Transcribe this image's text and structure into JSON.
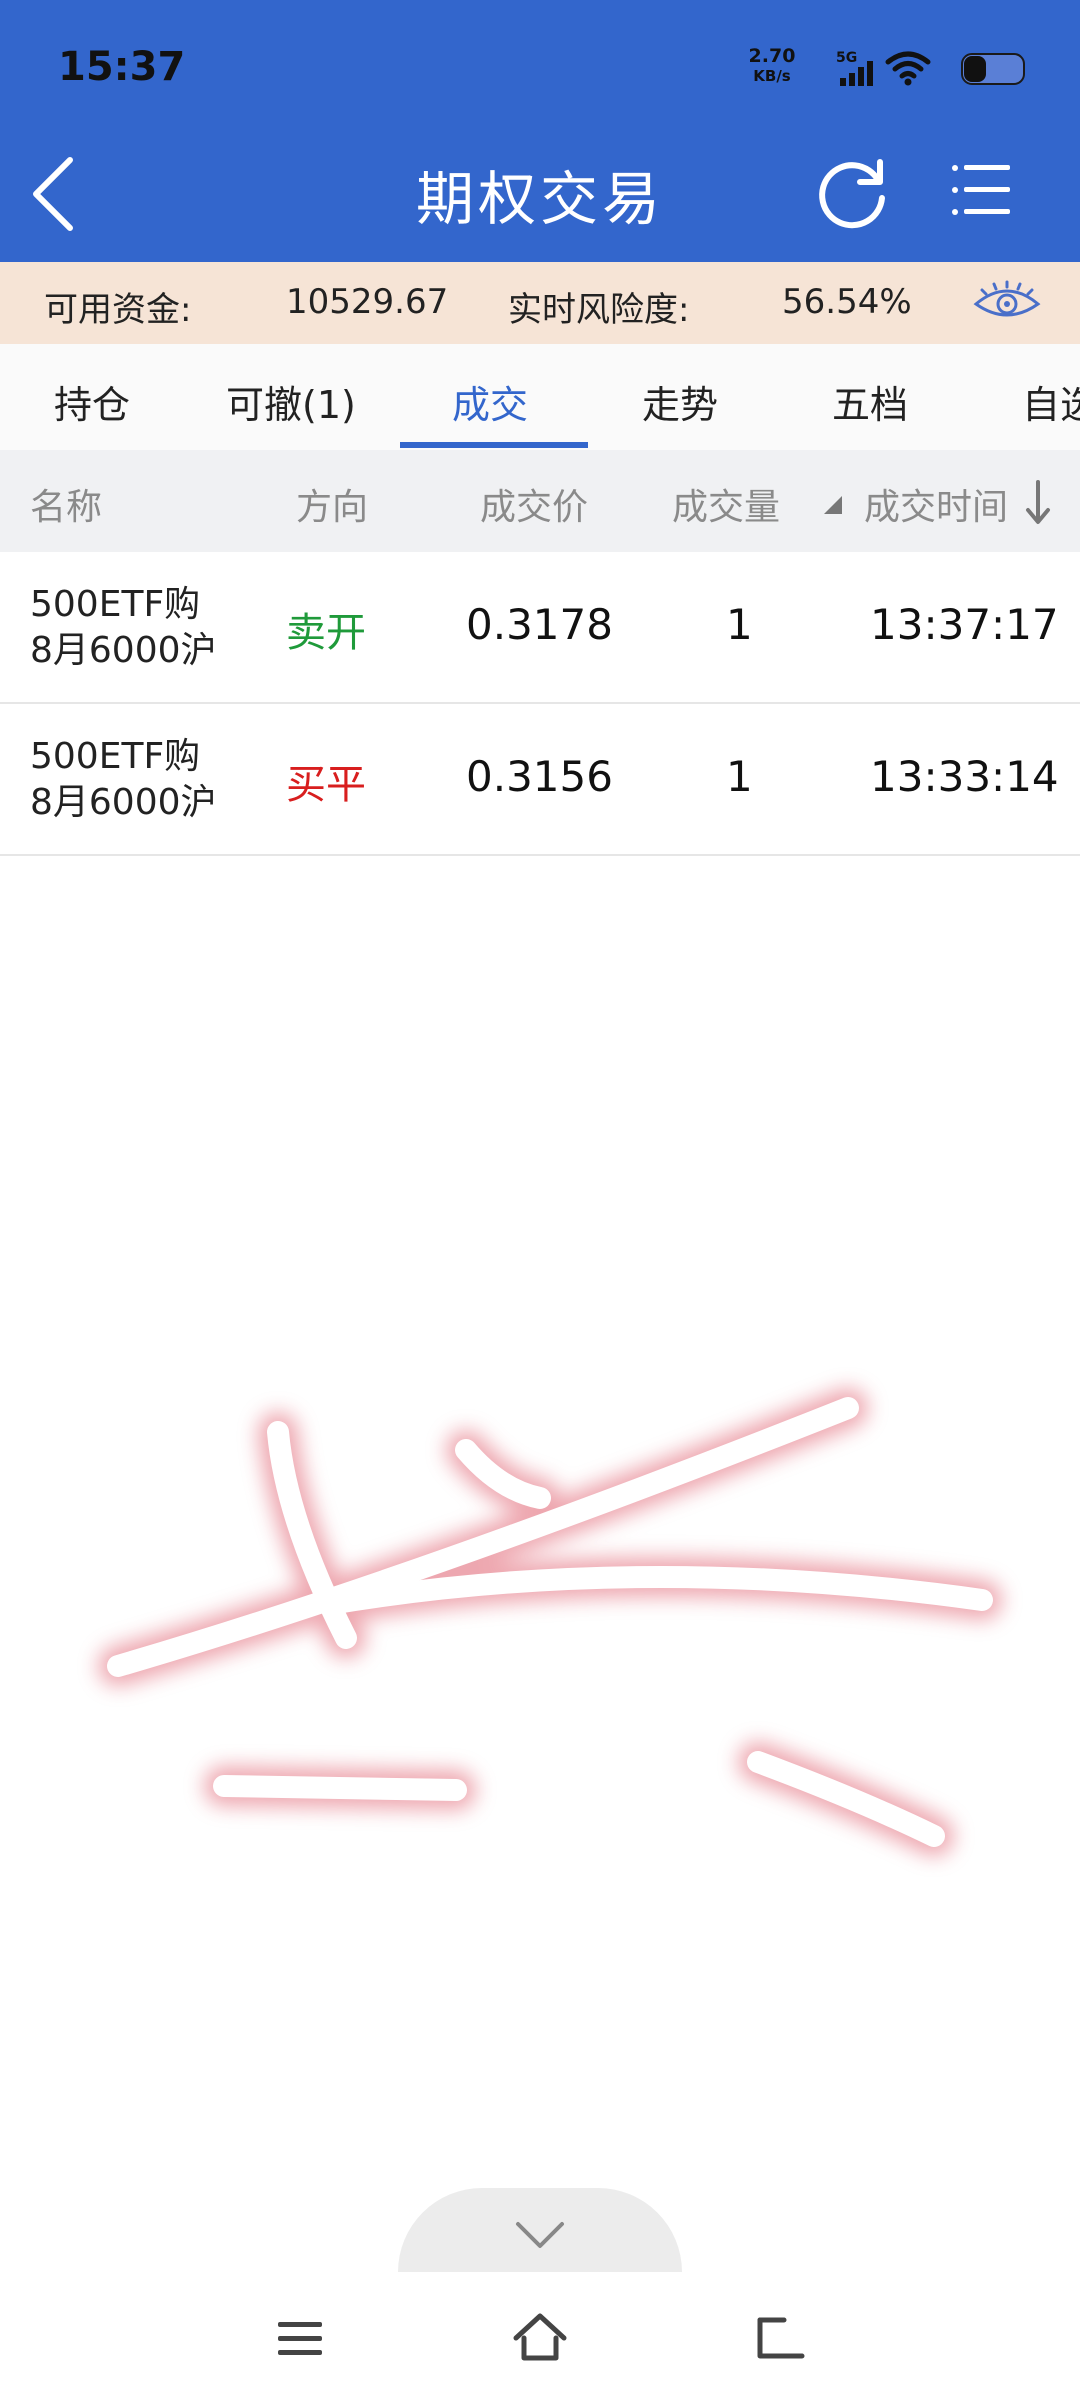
{
  "status_bar": {
    "time": "15:37",
    "net_speed_value": "2.70",
    "net_speed_unit": "KB/s",
    "network": "5G"
  },
  "header": {
    "title": "期权交易",
    "icons": [
      "back-icon",
      "refresh-icon",
      "list-menu-icon"
    ]
  },
  "account": {
    "funds_label": "可用资金:",
    "funds_value": "10529.67",
    "risk_label": "实时风险度:",
    "risk_value": "56.54%"
  },
  "tabs": [
    {
      "label": "持仓"
    },
    {
      "label": "可撤(1)"
    },
    {
      "label": "成交",
      "active": true
    },
    {
      "label": "走势"
    },
    {
      "label": "五档"
    },
    {
      "label": "自选"
    }
  ],
  "columns": [
    "名称",
    "方向",
    "成交价",
    "成交量",
    "成交时间"
  ],
  "trades": [
    {
      "name_line1": "500ETF购",
      "name_line2": "8月6000沪",
      "direction": "卖开",
      "price": "0.3178",
      "qty": "1",
      "time": "13:37:17"
    },
    {
      "name_line1": "500ETF购",
      "name_line2": "8月6000沪",
      "direction": "买平",
      "price": "0.3156",
      "qty": "1",
      "time": "13:33:14"
    }
  ],
  "colors": {
    "header_blue": "#3366cc",
    "account_bar": "#f6e4d6",
    "sell_green": "#1f9a3a",
    "buy_red": "#d81e1e"
  }
}
